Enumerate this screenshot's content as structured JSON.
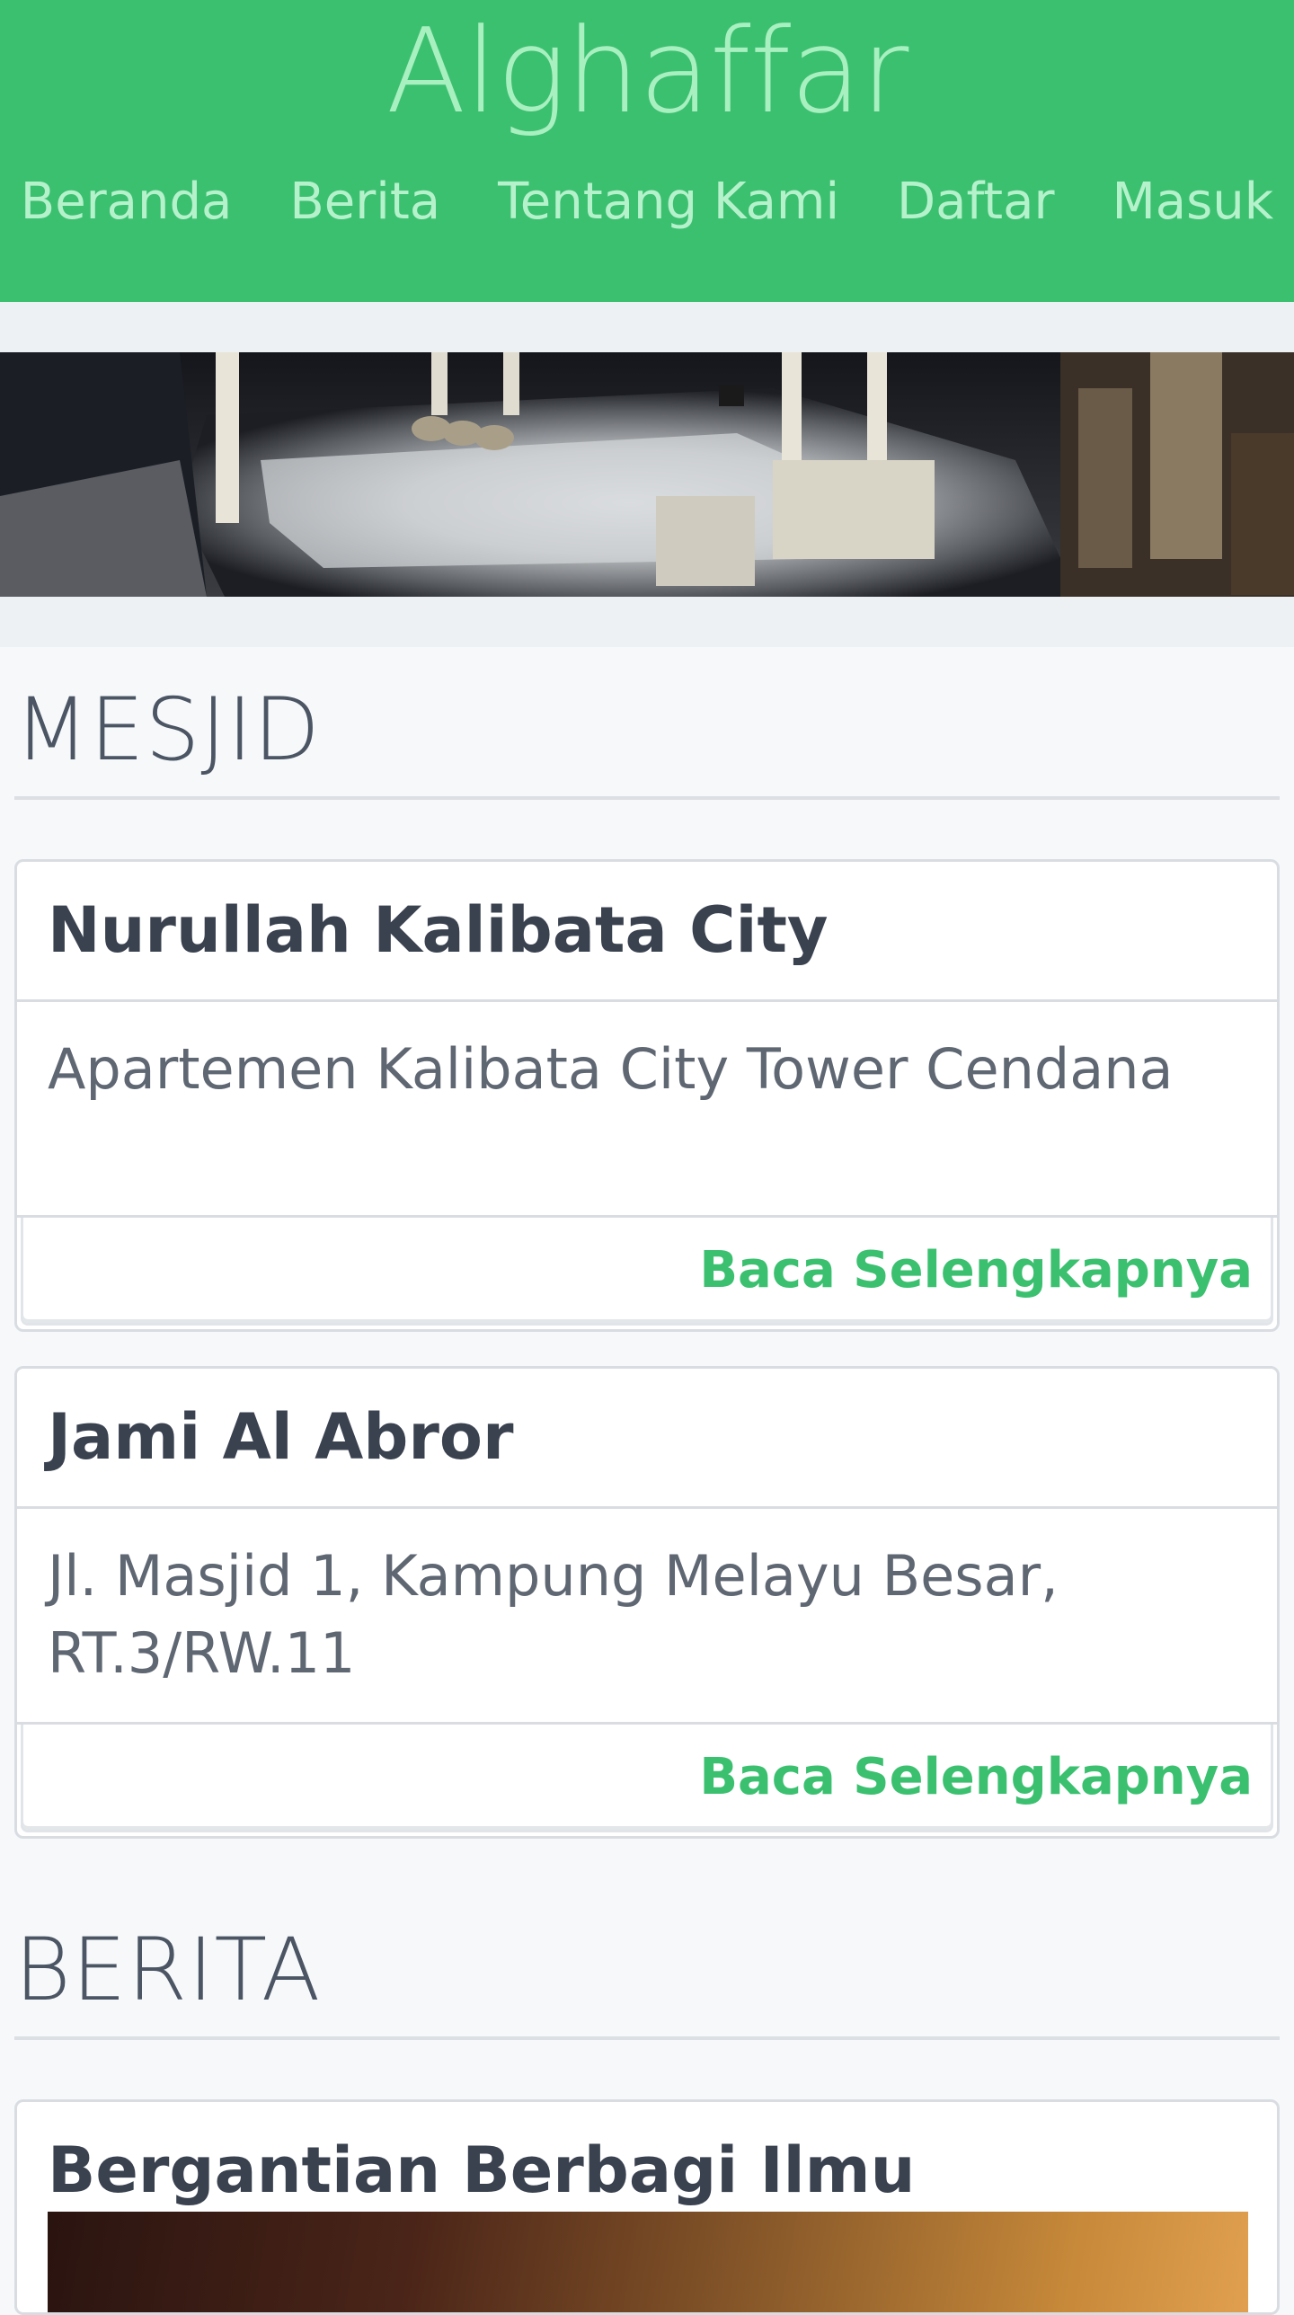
{
  "brand": "Alghaffar",
  "nav": [
    "Beranda",
    "Berita",
    "Tentang Kami",
    "Daftar",
    "Masuk"
  ],
  "sections": {
    "mesjid": "MESJID",
    "berita": "BERITA"
  },
  "mosques": [
    {
      "name": "Nurullah Kalibata City",
      "address": "Apartemen Kalibata City Tower Cendana",
      "link": "Baca Selengkapnya"
    },
    {
      "name": "Jami Al Abror",
      "address": "Jl. Masjid 1, Kampung Melayu Besar, RT.3/RW.11",
      "link": "Baca Selengkapnya"
    }
  ],
  "news": [
    {
      "title": "Bergantian Berbagi Ilmu"
    }
  ],
  "colors": {
    "brand_green": "#3bc070",
    "link_green": "#3bc070"
  }
}
